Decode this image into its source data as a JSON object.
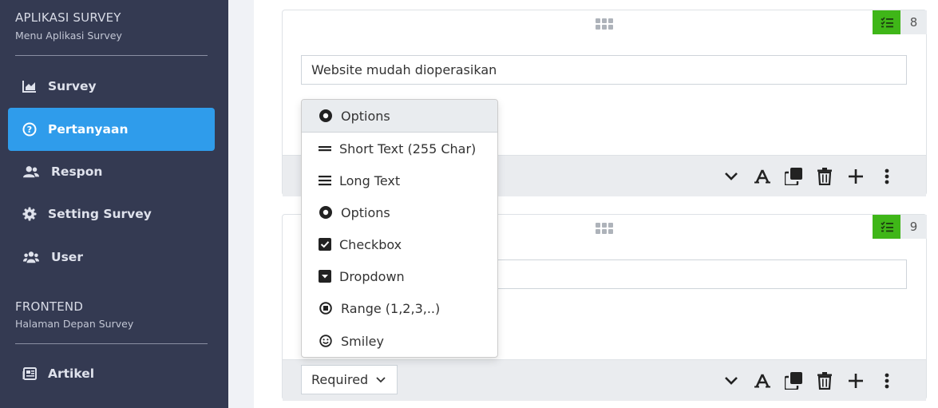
{
  "sidebar": {
    "app_title": "APLIKASI SURVEY",
    "app_subtitle": "Menu Aplikasi Survey",
    "frontend_title": "FRONTEND",
    "frontend_subtitle": "Halaman Depan Survey",
    "items": [
      {
        "label": "Survey",
        "icon": "chart-area-icon"
      },
      {
        "label": "Pertanyaan",
        "icon": "question-circle-icon",
        "active": true
      },
      {
        "label": "Respon",
        "icon": "users-icon"
      },
      {
        "label": "Setting Survey",
        "icon": "gear-icon"
      },
      {
        "label": "User",
        "icon": "users-group-icon"
      },
      {
        "label": "Artikel",
        "icon": "newspaper-icon"
      }
    ]
  },
  "questions": [
    {
      "number": "8",
      "text": "Website mudah dioperasikan"
    },
    {
      "number": "9",
      "text": ""
    }
  ],
  "required_label": "Required",
  "type_dropdown": {
    "selected": "Options",
    "options": [
      {
        "label": "Short Text (255 Char)",
        "icon": "short-text-icon"
      },
      {
        "label": "Long Text",
        "icon": "long-text-icon"
      },
      {
        "label": "Options",
        "icon": "radio-icon"
      },
      {
        "label": "Checkbox",
        "icon": "checkbox-icon"
      },
      {
        "label": "Dropdown",
        "icon": "dropdown-icon"
      },
      {
        "label": "Range (1,2,3,..)",
        "icon": "range-icon"
      },
      {
        "label": "Smiley",
        "icon": "smiley-icon"
      }
    ]
  },
  "colors": {
    "sidebar_bg": "#343a52",
    "active": "#2f9ceb",
    "badge_green": "#3fb618"
  }
}
